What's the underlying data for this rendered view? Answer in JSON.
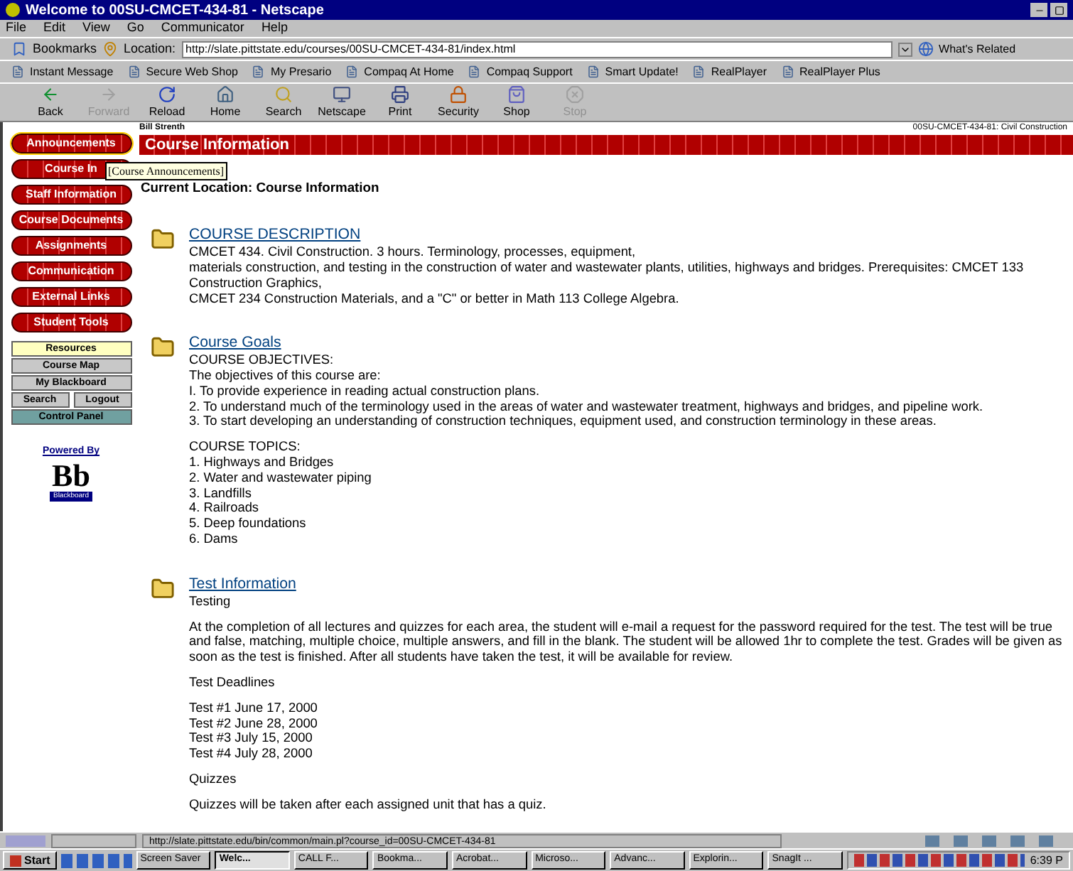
{
  "window": {
    "title": "Welcome to 00SU-CMCET-434-81 - Netscape"
  },
  "menu": [
    "File",
    "Edit",
    "View",
    "Go",
    "Communicator",
    "Help"
  ],
  "location_bar": {
    "bookmarks": "Bookmarks",
    "label": "Location:",
    "url": "http://slate.pittstate.edu/courses/00SU-CMCET-434-81/index.html",
    "related": "What's Related"
  },
  "personal_toolbar": [
    "Instant Message",
    "Secure Web Shop",
    "My Presario",
    "Compaq At Home",
    "Compaq Support",
    "Smart Update!",
    "RealPlayer",
    "RealPlayer Plus"
  ],
  "nav_buttons": [
    {
      "label": "Back",
      "kind": "back",
      "disabled": false
    },
    {
      "label": "Forward",
      "kind": "forward",
      "disabled": true
    },
    {
      "label": "Reload",
      "kind": "reload",
      "disabled": false
    },
    {
      "label": "Home",
      "kind": "home",
      "disabled": false
    },
    {
      "label": "Search",
      "kind": "search",
      "disabled": false
    },
    {
      "label": "Netscape",
      "kind": "netscape",
      "disabled": false
    },
    {
      "label": "Print",
      "kind": "print",
      "disabled": false
    },
    {
      "label": "Security",
      "kind": "security",
      "disabled": false
    },
    {
      "label": "Shop",
      "kind": "shop",
      "disabled": false
    },
    {
      "label": "Stop",
      "kind": "stop",
      "disabled": true
    }
  ],
  "page": {
    "instructor": "Bill Strenth",
    "course_code": "00SU-CMCET-434-81: Civil Construction",
    "header_title": "Course Information",
    "sidebar_buttons": [
      {
        "label": "Announcements",
        "selected": true
      },
      {
        "label": "Course In",
        "selected": false
      },
      {
        "label": "Staff Information",
        "selected": false
      },
      {
        "label": "Course Documents",
        "selected": false
      },
      {
        "label": "Assignments",
        "selected": false
      },
      {
        "label": "Communication",
        "selected": false
      },
      {
        "label": "External Links",
        "selected": false
      },
      {
        "label": "Student Tools",
        "selected": false
      }
    ],
    "tooltip": "[Course Announcements]",
    "tool_links": [
      {
        "label": "Resources",
        "kind": "yellow"
      },
      {
        "label": "Course Map",
        "kind": "gray"
      },
      {
        "label": "My Blackboard",
        "kind": "gray"
      },
      {
        "label": "Search",
        "kind": "half"
      },
      {
        "label": "Logout",
        "kind": "half"
      },
      {
        "label": "Control Panel",
        "kind": "teal"
      }
    ],
    "powered_by": "Powered By",
    "logo": "Bb",
    "logo_sub": "Blackboard",
    "current_location": "Current Location: Course Information",
    "sections": [
      {
        "title": "COURSE DESCRIPTION",
        "blocks": [
          [
            "CMCET 434. Civil Construction. 3 hours. Terminology, processes, equipment,",
            "materials construction, and testing in the construction of water and wastewater plants, utilities, highways and bridges. Prerequisites: CMCET 133",
            "Construction Graphics,",
            "CMCET 234 Construction Materials, and a \"C\" or better in Math 113 College Algebra."
          ]
        ]
      },
      {
        "title": "Course Goals",
        "blocks": [
          [
            "COURSE OBJECTIVES:",
            "The objectives of this course are:",
            "I. To provide experience in reading actual construction plans.",
            "2. To understand much of the terminology used in the areas of water and wastewater treatment, highways and bridges, and pipeline work.",
            "3. To start developing an understanding of construction techniques, equipment used, and construction terminology in these areas."
          ],
          [
            "COURSE TOPICS:",
            "1. Highways and Bridges",
            "2. Water and wastewater piping",
            "3. Landfills",
            "4. Railroads",
            "5. Deep foundations",
            "6. Dams"
          ]
        ]
      },
      {
        "title": "Test Information",
        "blocks": [
          [
            "Testing"
          ],
          [
            "At the completion of all lectures and quizzes for each area, the student will e-mail a request for the password required for the test. The test will be true and false, matching, multiple choice, multiple answers, and fill in the blank. The student will be allowed 1hr to complete the test. Grades will be given as soon as the test is finished. After all students have taken the test, it will be available for review."
          ],
          [
            "Test Deadlines"
          ],
          [
            "Test #1 June 17, 2000",
            "Test #2 June 28, 2000",
            "Test #3 July 15, 2000",
            "Test #4 July 28, 2000"
          ],
          [
            "Quizzes"
          ],
          [
            "Quizzes will be taken after each assigned unit that has a quiz."
          ]
        ]
      }
    ]
  },
  "status_bar": {
    "url": "http://slate.pittstate.edu/bin/common/main.pl?course_id=00SU-CMCET-434-81"
  },
  "taskbar": {
    "start": "Start",
    "items": [
      {
        "label": "Screen Saver",
        "selected": false
      },
      {
        "label": "Welc...",
        "selected": true
      },
      {
        "label": "CALL F...",
        "selected": false
      },
      {
        "label": "Bookma...",
        "selected": false
      },
      {
        "label": "Acrobat...",
        "selected": false
      },
      {
        "label": "Microso...",
        "selected": false
      },
      {
        "label": "Advanc...",
        "selected": false
      },
      {
        "label": "Explorin...",
        "selected": false
      },
      {
        "label": "SnagIt ...",
        "selected": false
      }
    ],
    "clock": "6:39 P"
  }
}
